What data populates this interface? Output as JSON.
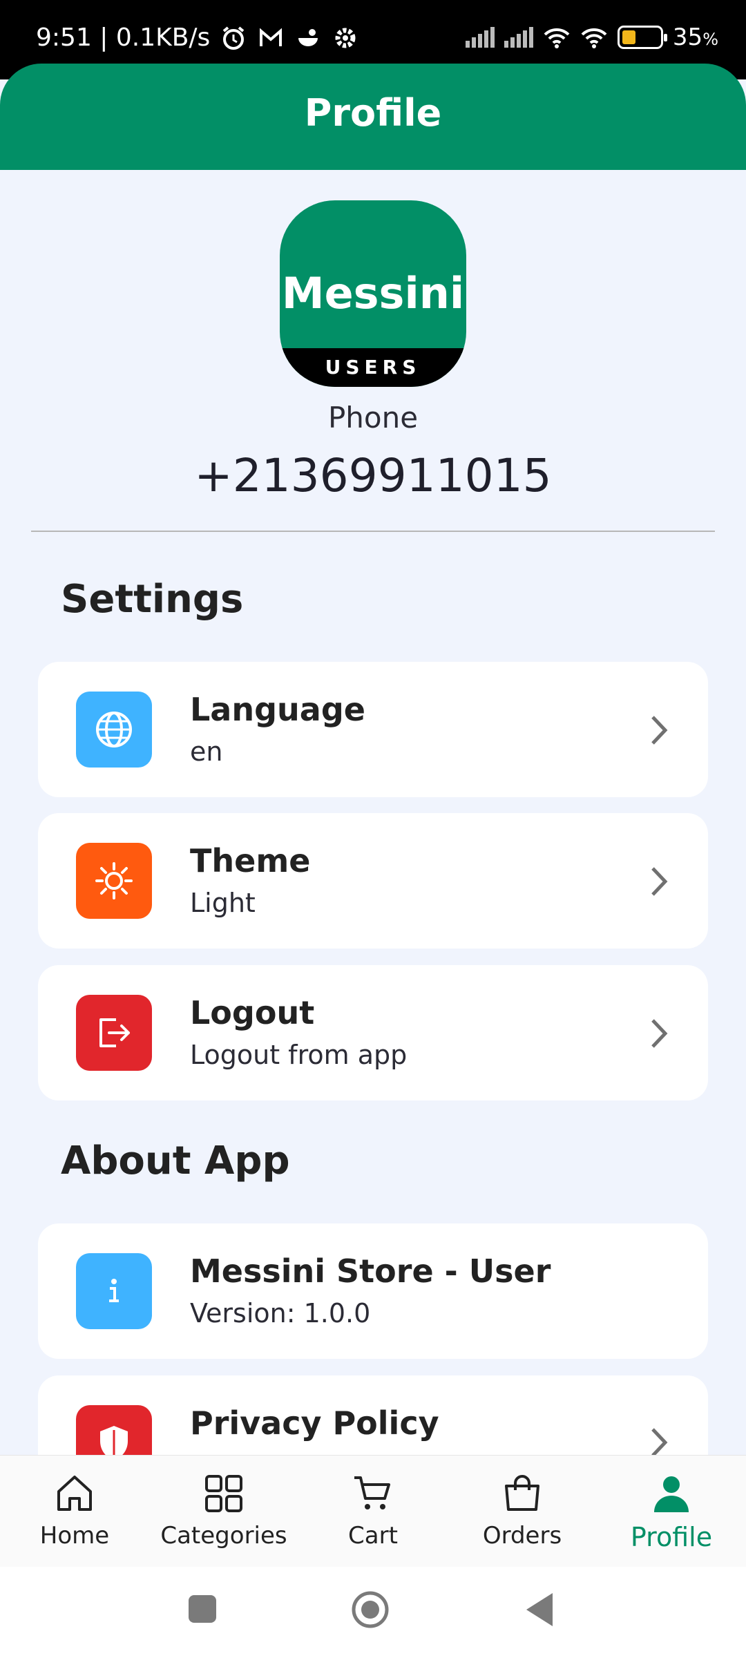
{
  "status_bar": {
    "time_speed": "9:51 | 0.1KB/s",
    "battery": "35",
    "battery_symbol": "%"
  },
  "header": {
    "title": "Profile"
  },
  "profile": {
    "logo_name": "Messini",
    "logo_band": "USERS",
    "phone_label": "Phone",
    "phone_value": "+21369911015"
  },
  "settings": {
    "title": "Settings",
    "items": [
      {
        "title": "Language",
        "subtitle": "en",
        "icon": "globe-icon",
        "color": "#3fb3ff"
      },
      {
        "title": "Theme",
        "subtitle": "Light",
        "icon": "sun-icon",
        "color": "#ff5a0f"
      },
      {
        "title": "Logout",
        "subtitle": "Logout from app",
        "icon": "logout-icon",
        "color": "#e1262c"
      }
    ]
  },
  "about": {
    "title": "About App",
    "items": [
      {
        "title": "Messini Store - User",
        "subtitle": "Version: 1.0.0",
        "icon": "info-icon",
        "color": "#3fb3ff"
      },
      {
        "title": "Privacy Policy",
        "icon": "shield-icon",
        "color": "#e1262c"
      }
    ]
  },
  "bottom_nav": {
    "items": [
      {
        "label": "Home",
        "icon": "home-icon"
      },
      {
        "label": "Categories",
        "icon": "grid-icon"
      },
      {
        "label": "Cart",
        "icon": "cart-icon"
      },
      {
        "label": "Orders",
        "icon": "bag-icon"
      },
      {
        "label": "Profile",
        "icon": "person-icon",
        "active": true
      }
    ],
    "accent": "#028f66"
  }
}
